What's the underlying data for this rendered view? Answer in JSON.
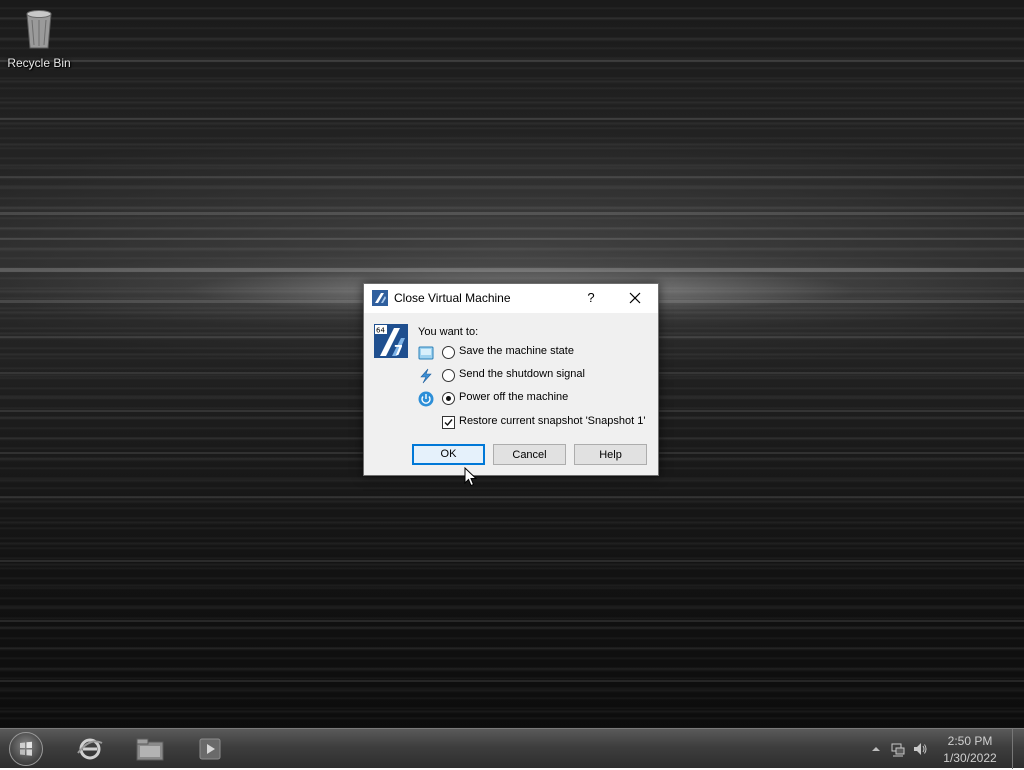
{
  "desktop": {
    "icons": [
      {
        "label": "Recycle Bin",
        "icon": "recycle-bin-icon"
      }
    ]
  },
  "dialog": {
    "title": "Close Virtual Machine",
    "help_glyph": "?",
    "prompt": "You want to:",
    "options": [
      {
        "label": "Save the machine state",
        "icon": "save-state-icon",
        "selected": false
      },
      {
        "label": "Send the shutdown signal",
        "icon": "shutdown-signal-icon",
        "selected": false
      },
      {
        "label": "Power off the machine",
        "icon": "power-off-icon",
        "selected": true
      }
    ],
    "restore_snapshot": {
      "label": "Restore current snapshot 'Snapshot 1'",
      "checked": true
    },
    "buttons": {
      "ok": "OK",
      "cancel": "Cancel",
      "help": "Help"
    }
  },
  "taskbar": {
    "apps": [
      "internet-explorer-icon",
      "file-explorer-icon",
      "media-player-icon"
    ],
    "tray": [
      "show-hidden-icons-icon",
      "network-icon",
      "volume-icon"
    ],
    "clock": {
      "time": "2:50 PM",
      "date": "1/30/2022"
    }
  },
  "colors": {
    "dialog_bg": "#f0f0f0",
    "default_button_border": "#0078d7"
  }
}
